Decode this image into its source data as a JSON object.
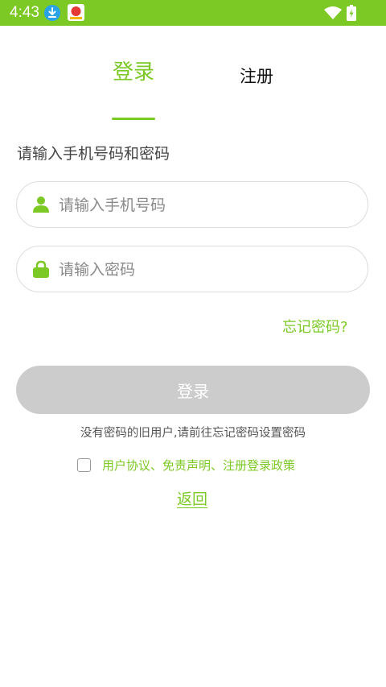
{
  "status_bar": {
    "time": "4:43",
    "background": "#7cc825",
    "icons": [
      "download-icon",
      "app-notification-icon",
      "wifi-icon",
      "battery-charging-icon"
    ]
  },
  "tabs": {
    "login_label": "登录",
    "register_label": "注册",
    "active": "login"
  },
  "form": {
    "prompt": "请输入手机号码和密码",
    "phone": {
      "placeholder": "请输入手机号码",
      "value": "",
      "icon": "user-icon"
    },
    "password": {
      "placeholder": "请输入密码",
      "value": "",
      "icon": "lock-icon"
    },
    "forgot_label": "忘记密码?",
    "login_button_label": "登录",
    "hint": "没有密码的旧用户,请前往忘记密码设置密码",
    "agreement_label": "用户协议、免责声明、注册登录政策",
    "agreement_checked": false,
    "back_label": "返回"
  },
  "colors": {
    "accent": "#7cc825",
    "button_disabled": "#cccccc",
    "field_border": "#dcdcdc"
  }
}
